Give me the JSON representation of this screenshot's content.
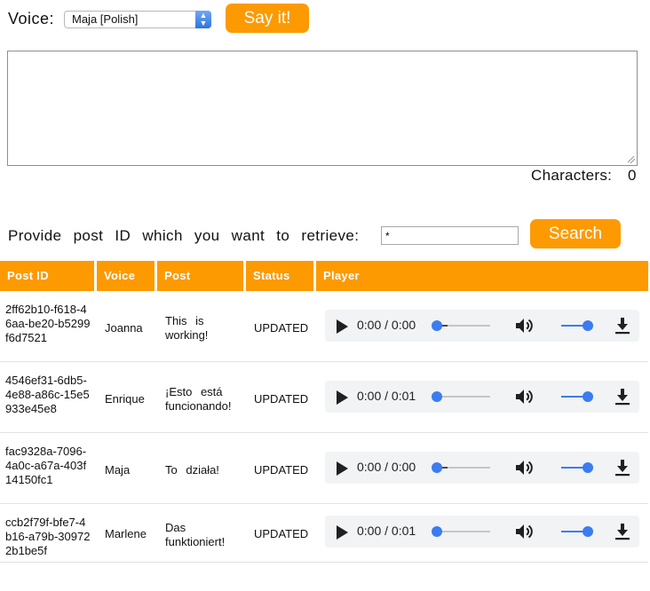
{
  "header": {
    "voice_label": "Voice:",
    "voice_selected": "Maja [Polish]",
    "say_button": "Say it!"
  },
  "editor": {
    "text": "",
    "characters_label": "Characters:",
    "characters_count": "0"
  },
  "search": {
    "label": "Provide post ID which you want to retrieve:",
    "value": "*",
    "button": "Search"
  },
  "table": {
    "columns": [
      "Post ID",
      "Voice",
      "Post",
      "Status",
      "Player"
    ],
    "rows": [
      {
        "id": "2ff62b10-f618-46aa-be20-b5299f6d7521",
        "voice": "Joanna",
        "post": "This is working!",
        "status": "UPDATED",
        "time": "0:00 / 0:00",
        "progress": 0.0,
        "buffered": 0.2,
        "volume": 1.0
      },
      {
        "id": "4546ef31-6db5-4e88-a86c-15e5933e45e8",
        "voice": "Enrique",
        "post": "¡Esto está funcionando!",
        "status": "UPDATED",
        "time": "0:00 / 0:01",
        "progress": 0.0,
        "buffered": 0.0,
        "volume": 1.0
      },
      {
        "id": "fac9328a-7096-4a0c-a67a-403f14150fc1",
        "voice": "Maja",
        "post": "To działa!",
        "status": "UPDATED",
        "time": "0:00 / 0:00",
        "progress": 0.0,
        "buffered": 0.2,
        "volume": 1.0
      },
      {
        "id": "ccb2f79f-bfe7-4b16-a79b-309722b1be5f",
        "voice": "Marlene",
        "post": "Das funktioniert!",
        "status": "UPDATED",
        "time": "0:00 / 0:01",
        "progress": 0.0,
        "buffered": 0.0,
        "volume": 1.0
      }
    ]
  },
  "icons": {
    "play": "play-icon",
    "volume": "volume-icon",
    "download": "download-icon",
    "select": "chevron-updown-icon"
  },
  "colors": {
    "accent": "#fd9a01",
    "slider": "#3b7cf0"
  }
}
